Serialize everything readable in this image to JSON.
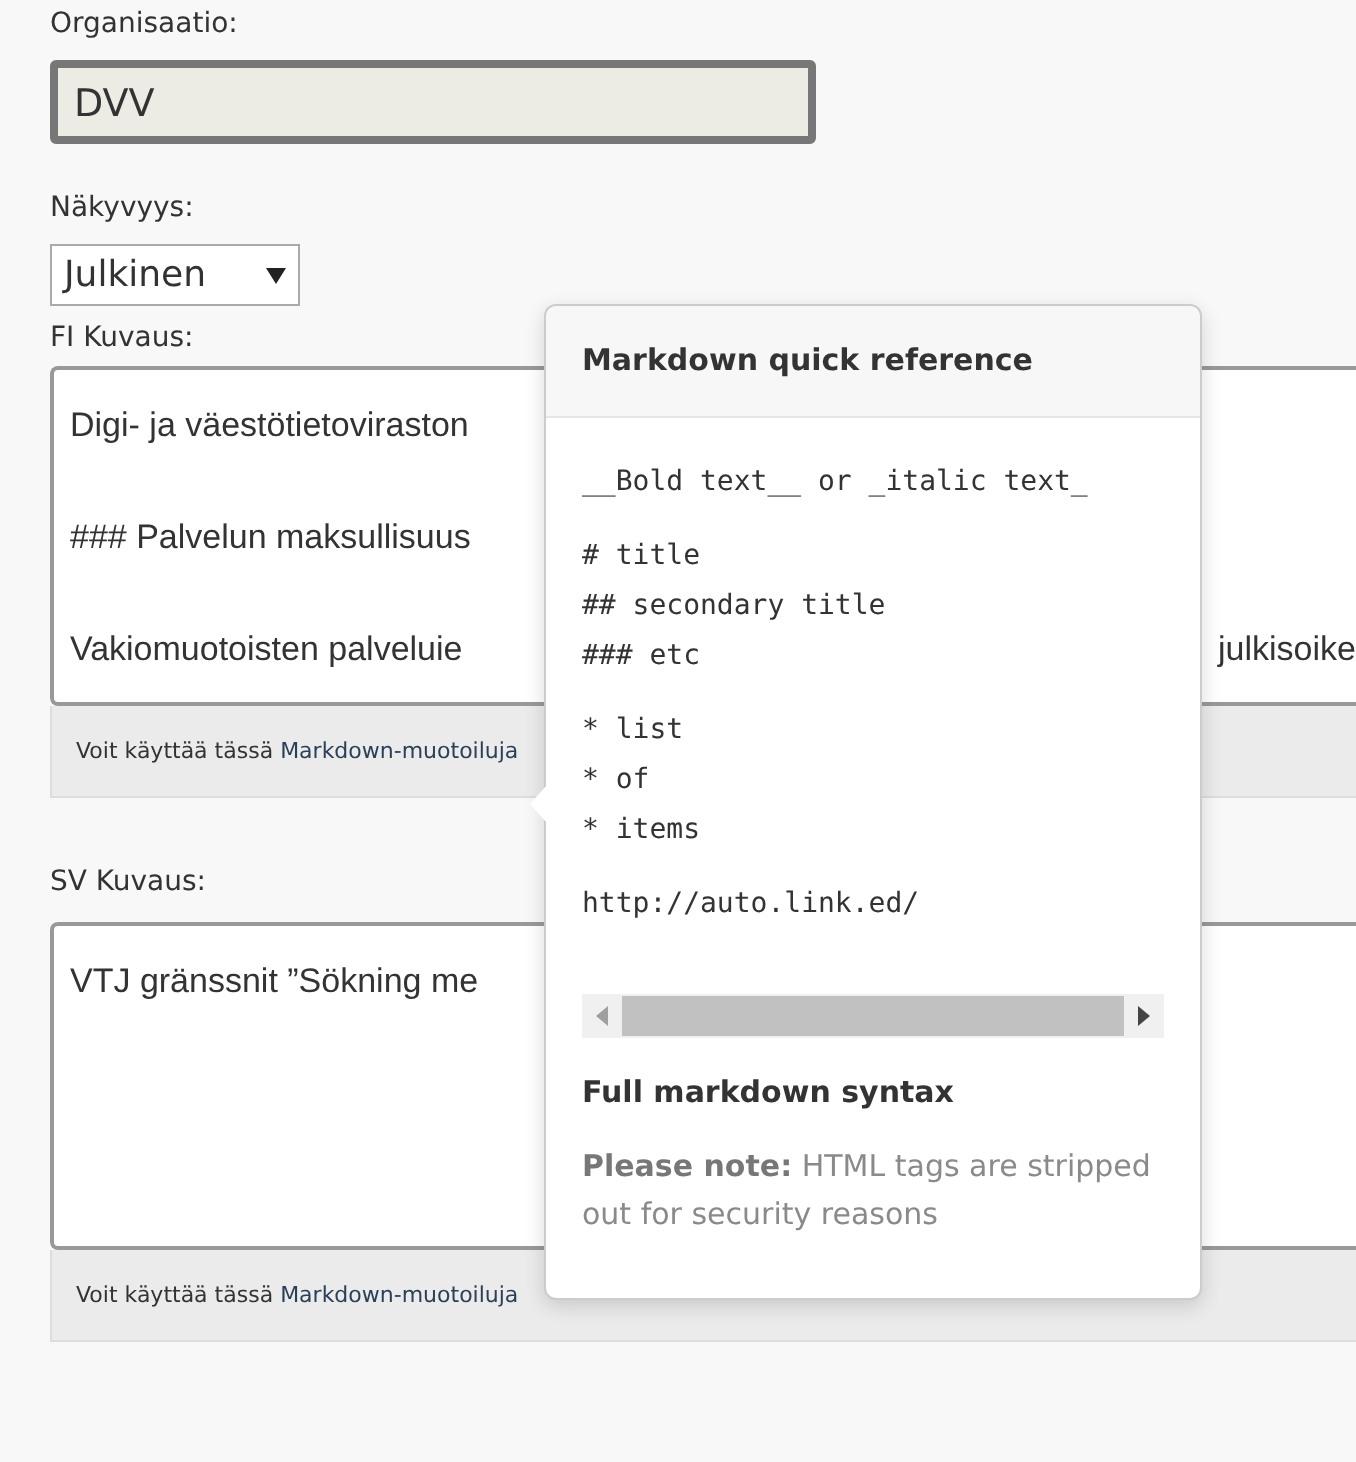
{
  "organisation": {
    "label": "Organisaatio:",
    "value": "DVV"
  },
  "visibility": {
    "label": "Näkyvyys:",
    "value": "Julkinen"
  },
  "fi_description": {
    "label": "FI Kuvaus:",
    "lines": [
      {
        "left": "Digi- ja väestötietoviraston"
      },
      {
        "left": "### Palvelun maksullisuus"
      },
      {
        "left": "Vakiomuotoisten palveluie",
        "right": "julkisoike"
      }
    ],
    "hint": "Voit käyttää tässä",
    "hint_link": "Markdown-muotoiluja"
  },
  "sv_description": {
    "label": "SV Kuvaus:",
    "lines": [
      {
        "left": "VTJ gränssnit ”Sökning me"
      }
    ],
    "hint": "Voit käyttää tässä",
    "hint_link": "Markdown-muotoiluja"
  },
  "popover": {
    "title": "Markdown quick reference",
    "code_groups": [
      [
        "__Bold text__ or _italic text_"
      ],
      [
        "# title",
        "## secondary title",
        "### etc"
      ],
      [
        "* list",
        "* of",
        "* items"
      ],
      [
        "http://auto.link.ed/"
      ]
    ],
    "link": "Full markdown syntax",
    "note": "**Please note:** HTML tags are stripped out for security reasons"
  }
}
